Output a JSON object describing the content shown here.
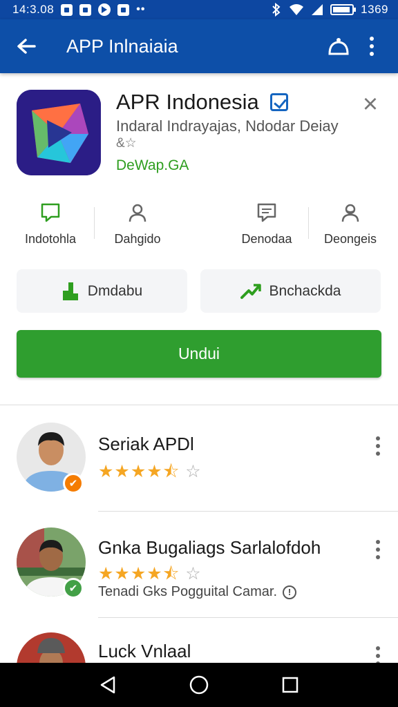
{
  "status_bar": {
    "time": "14:3.08",
    "right_time": "1369",
    "icons": [
      "notification-box-icon",
      "notification-box-icon",
      "play-circle-icon",
      "message-icon",
      "more-dots-icon",
      "bluetooth-icon",
      "wifi-icon",
      "signal-icon",
      "battery-icon"
    ]
  },
  "app_bar": {
    "title": "APP Inlnaiaia",
    "back_icon": "arrow-back-icon",
    "actions": [
      "notification-bell-icon",
      "overflow-menu-icon"
    ]
  },
  "app": {
    "name": "APR Indonesia",
    "subtitle": "Indaral Indrayajas, Ndodar Deiay",
    "rating_mini": "&☆",
    "developer": "DeWap.GA",
    "colors": {
      "icon_bg": "#2b1d86",
      "developer": "#2e9e1f",
      "accent": "#0d4fa8"
    }
  },
  "quick_actions": [
    {
      "label": "Indotohla",
      "icon": "chat-bubble-icon"
    },
    {
      "label": "Dahgido",
      "icon": "person-icon"
    },
    {
      "label": "Denodaa",
      "icon": "message-square-icon"
    },
    {
      "label": "Deongeis",
      "icon": "people-icon"
    }
  ],
  "secondary_buttons": [
    {
      "label": "Dmdabu",
      "icon": "chart-icon"
    },
    {
      "label": "Bnchackda",
      "icon": "trending-icon"
    }
  ],
  "install": {
    "label": "Undui",
    "color": "#2f9e2f"
  },
  "reviews": [
    {
      "name": "Seriak APDl",
      "rating": 4.5,
      "text": "",
      "badge_color": "#f57c00"
    },
    {
      "name": "Gnka Bugaliags Sarlalofdoh",
      "rating": 4.5,
      "text": "Tenadi Gks Pogguital Camar.",
      "badge_color": "#43a047"
    },
    {
      "name": "Luck Vnlaal",
      "rating": null,
      "text": "",
      "badge_color": ""
    }
  ]
}
